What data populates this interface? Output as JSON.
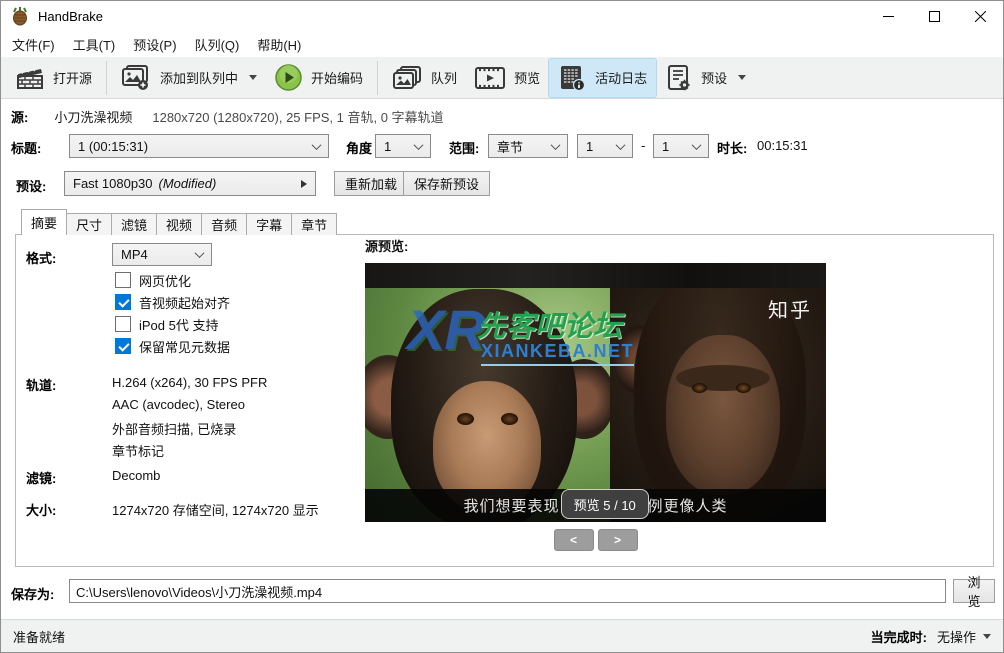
{
  "window": {
    "title": "HandBrake"
  },
  "menu": {
    "items": [
      "文件(F)",
      "工具(T)",
      "预设(P)",
      "队列(Q)",
      "帮助(H)"
    ]
  },
  "toolbar": {
    "open_source": "打开源",
    "add_to_queue": "添加到队列中",
    "start_encode": "开始编码",
    "queue": "队列",
    "preview": "预览",
    "activity_log": "活动日志",
    "presets": "预设"
  },
  "source_row": {
    "label": "源:",
    "name": "小刀洗澡视频",
    "info": "1280x720 (1280x720), 25 FPS, 1 音轨, 0 字幕轨道"
  },
  "title_row": {
    "title_label": "标题:",
    "title_value": "1 (00:15:31)",
    "angle_label": "角度",
    "angle_value": "1",
    "range_label": "范围:",
    "range_type": "章节",
    "range_from": "1",
    "dash": "-",
    "range_to": "1",
    "duration_label": "时长:",
    "duration_value": "00:15:31"
  },
  "preset_row": {
    "label": "预设:",
    "value": "Fast 1080p30",
    "modified": "(Modified)",
    "reload_button": "重新加载",
    "save_new_button": "保存新预设"
  },
  "tabs": {
    "items": [
      "摘要",
      "尺寸",
      "滤镜",
      "视频",
      "音频",
      "字幕",
      "章节"
    ],
    "active_index": 0
  },
  "summary": {
    "format_label": "格式:",
    "format_value": "MP4",
    "checkboxes": [
      {
        "label": "网页优化",
        "checked": false
      },
      {
        "label": "音视频起始对齐",
        "checked": true
      },
      {
        "label": "iPod 5代 支持",
        "checked": false
      },
      {
        "label": "保留常见元数据",
        "checked": true
      }
    ],
    "tracks_label": "轨道:",
    "tracks": [
      "H.264 (x264), 30 FPS PFR",
      "AAC (avcodec), Stereo",
      "外部音频扫描, 已烧录",
      "章节标记"
    ],
    "filters_label": "滤镜:",
    "filters_value": "Decomb",
    "size_label": "大小:",
    "size_value": "1274x720 存储空间, 1274x720 显示"
  },
  "preview": {
    "label": "源预览:",
    "watermark_logo": "XR",
    "watermark_green": "先客吧论坛",
    "watermark_blue": "XIANKEBA.NET",
    "watermark_top_right": "知乎",
    "subtitle_left": "我们想要表现",
    "subtitle_right": "例更像人类",
    "overlay_text": "预览 5 / 10",
    "prev_button": "<",
    "next_button": ">"
  },
  "save_row": {
    "label": "保存为:",
    "path": "C:\\Users\\lenovo\\Videos\\小刀洗澡视频.mp4",
    "browse_button": "浏览"
  },
  "status_bar": {
    "left": "准备就绪",
    "when_done_label": "当完成时:",
    "when_done_value": "无操作"
  },
  "colors": {
    "accent_blue": "#0078d7",
    "toolbar_active_bg": "#cfe8f8",
    "play_green": "#7cb342"
  }
}
